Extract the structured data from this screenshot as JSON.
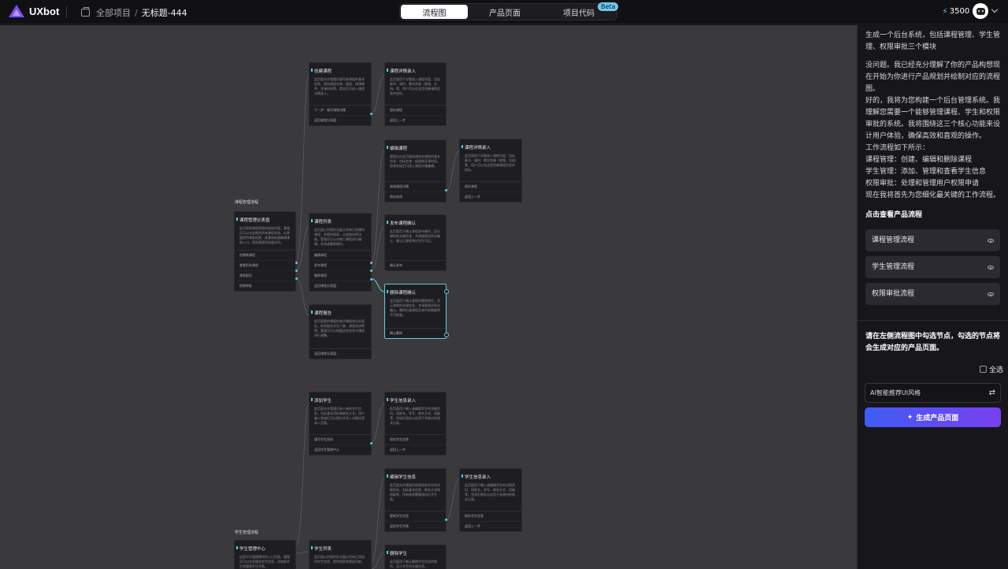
{
  "app": {
    "name": "UXbot"
  },
  "breadcrumb": {
    "root": "全部项目",
    "separator": "/",
    "current": "无标题-444"
  },
  "tabs": [
    {
      "label": "流程图",
      "active": true
    },
    {
      "label": "产品页面",
      "active": false
    },
    {
      "label": "项目代码",
      "active": false
    }
  ],
  "beta_badge": "Beta",
  "credits": "3500",
  "canvas": {
    "group_course": "课程管理流程",
    "group_student": "学生管理流程",
    "cards": {
      "course_dash": {
        "title": "课程管理仪表盘",
        "desc": "此页面是课程管理的起始页面，管理员可以在此概览所有课程状态。仪表盘提供课程创建、查看和批量编辑课程入口，帮助管理员快速访问。",
        "actions": [
          "创建新课程",
          "查看所有课程",
          "课程报告",
          "权限审批"
        ]
      },
      "create_course": {
        "title": "创建课程",
        "desc": "此页面允许管理员填写新课程的基本信息，例如课程名称、描述、授课教师、开课时间等。提交后可进入课程详情录入。",
        "actions": [
          "下一步：填写课程详情",
          "返回课程仪表盘"
        ]
      },
      "course_detail_1": {
        "title": "课程详情录入",
        "desc": "此页面用于详细录入课程内容，包括章节、课时、教学资源（视频、文档）等。用户可以在这里完善课程信息并保存。",
        "actions": [
          "保存课程",
          "返回上一步"
        ]
      },
      "course_list": {
        "title": "课程列表",
        "desc": "此页面以列表形式展示所有已创建的课程，并提供搜索、过滤和排序功能。管理员可以对每门课程进行编辑、发布或删除操作。",
        "actions": [
          "编辑课程",
          "发布课程",
          "删除课程",
          "返回课程仪表盘"
        ]
      },
      "edit_course": {
        "title": "编辑课程",
        "desc": "管理员在此页面修改现有课程的基本信息，包括名称、描述和开课时间。修改完成后可进入课程详情编辑。",
        "actions": [
          "修改课程详情",
          "保存修改"
        ]
      },
      "course_detail_2": {
        "title": "课程详情录入",
        "desc": "此页面用于详细录入课程内容，包括章节、课时、教学资源（视频、文档）等。用户可以在这里完善课程信息并保存。",
        "actions": [
          "保存课程",
          "返回上一步"
        ]
      },
      "publish_confirm": {
        "title": "发布课程确认",
        "desc": "此页面用于确认课程发布操作，显示课程的关键信息，并请管理员再次确认，确认后课程将对学生可见。",
        "actions": [
          "确认发布"
        ]
      },
      "delete_confirm": {
        "title": "删除课程确认",
        "desc": "此页面用于确认课程的删除操作，显示课程的关键信息，并请管理员再次确认。删除后该课程及其所有数据将不可恢复。",
        "actions": [
          "确认删除"
        ]
      },
      "course_report": {
        "title": "课程报告",
        "desc": "此页面提供课程的统计数据和分析报告，例如报名学生人数、课程完成率等。管理员可以根据这些信息对课程进行调整。",
        "actions": [
          "返回课程仪表盘"
        ]
      },
      "add_student": {
        "title": "添加学生",
        "desc": "此页面允许管理员录入新的学生信息，包括基本资料和联系方式。用户输入完成后可以保存并进入详细信息录入页面。",
        "actions": [
          "填写学生资料",
          "返回学生管理中心"
        ]
      },
      "student_info_1": {
        "title": "学生信息录入",
        "desc": "此页面用于输入或编辑学生的详细资料，如姓名、学号、联系方式、班级等。完成后保存以应用于系统内的相关记录。",
        "actions": [
          "保存学生信息",
          "返回上一步"
        ]
      },
      "edit_student": {
        "title": "编辑学生信息",
        "desc": "此页面允许管理员修改现有学生的详细资料，包括基本信息、联系方式和班级等，所有修改需要保存后才生效。",
        "actions": [
          "更新学生信息",
          "返回学生列表"
        ]
      },
      "student_info_2": {
        "title": "学生信息录入",
        "desc": "此页面用于输入或编辑学生的详细资料，如姓名、学号、联系方式、班级等。完成后保存以应用于系统内的相关记录。",
        "actions": [
          "保存学生信息",
          "返回上一步"
        ]
      },
      "student_center": {
        "title": "学生管理中心",
        "desc": "这是学生管理模块的入口页面，管理员可以在此概览学生信息，添加新学生和管理学生列表。",
        "actions": []
      },
      "student_list": {
        "title": "学生列表",
        "desc": "此页面以列表的形式展示所有已添加的学生信息，提供搜索和筛选功能。",
        "actions": []
      },
      "delete_student": {
        "title": "删除学生",
        "desc": "此页面用于确认删除学生信息的操作，显示学生的关键信息。",
        "actions": []
      }
    }
  },
  "sidebar": {
    "user_prompt": "生成一个后台系统，包括课程管理、学生管理、权限审批三个模块",
    "assistant_intro": "没问题。我已经充分理解了你的产品构想现在开始为你进行产品规划并绘制对应的流程图。",
    "assistant_lines": [
      "好的，我将为您构建一个后台管理系统。我理解您需要一个能够管理课程、学生和权限审批的系统。我将围绕这三个核心功能来设计用户体验，确保高效和直观的操作。",
      "工作流程如下所示：",
      "课程管理：创建、编辑和删除课程",
      "学生管理：添加、管理和查看学生信息",
      "权限审批：处理和管理用户权限申请",
      "现在我将首先为您细化最关键的工作流程。"
    ],
    "flows_title": "点击查看产品流程",
    "flows": [
      "课程管理流程",
      "学生管理流程",
      "权限审批流程"
    ],
    "gen_hint": "请在左侧流程图中勾选节点，勾选的节点将会生成对应的产品页面。",
    "select_all": "全选",
    "style_input": "AI智能推荐UI风格",
    "generate_button": "生成产品页面"
  },
  "colors": {
    "accent": "#5ec8e6",
    "button_from": "#3f5cf5",
    "button_to": "#7a3ff0"
  }
}
